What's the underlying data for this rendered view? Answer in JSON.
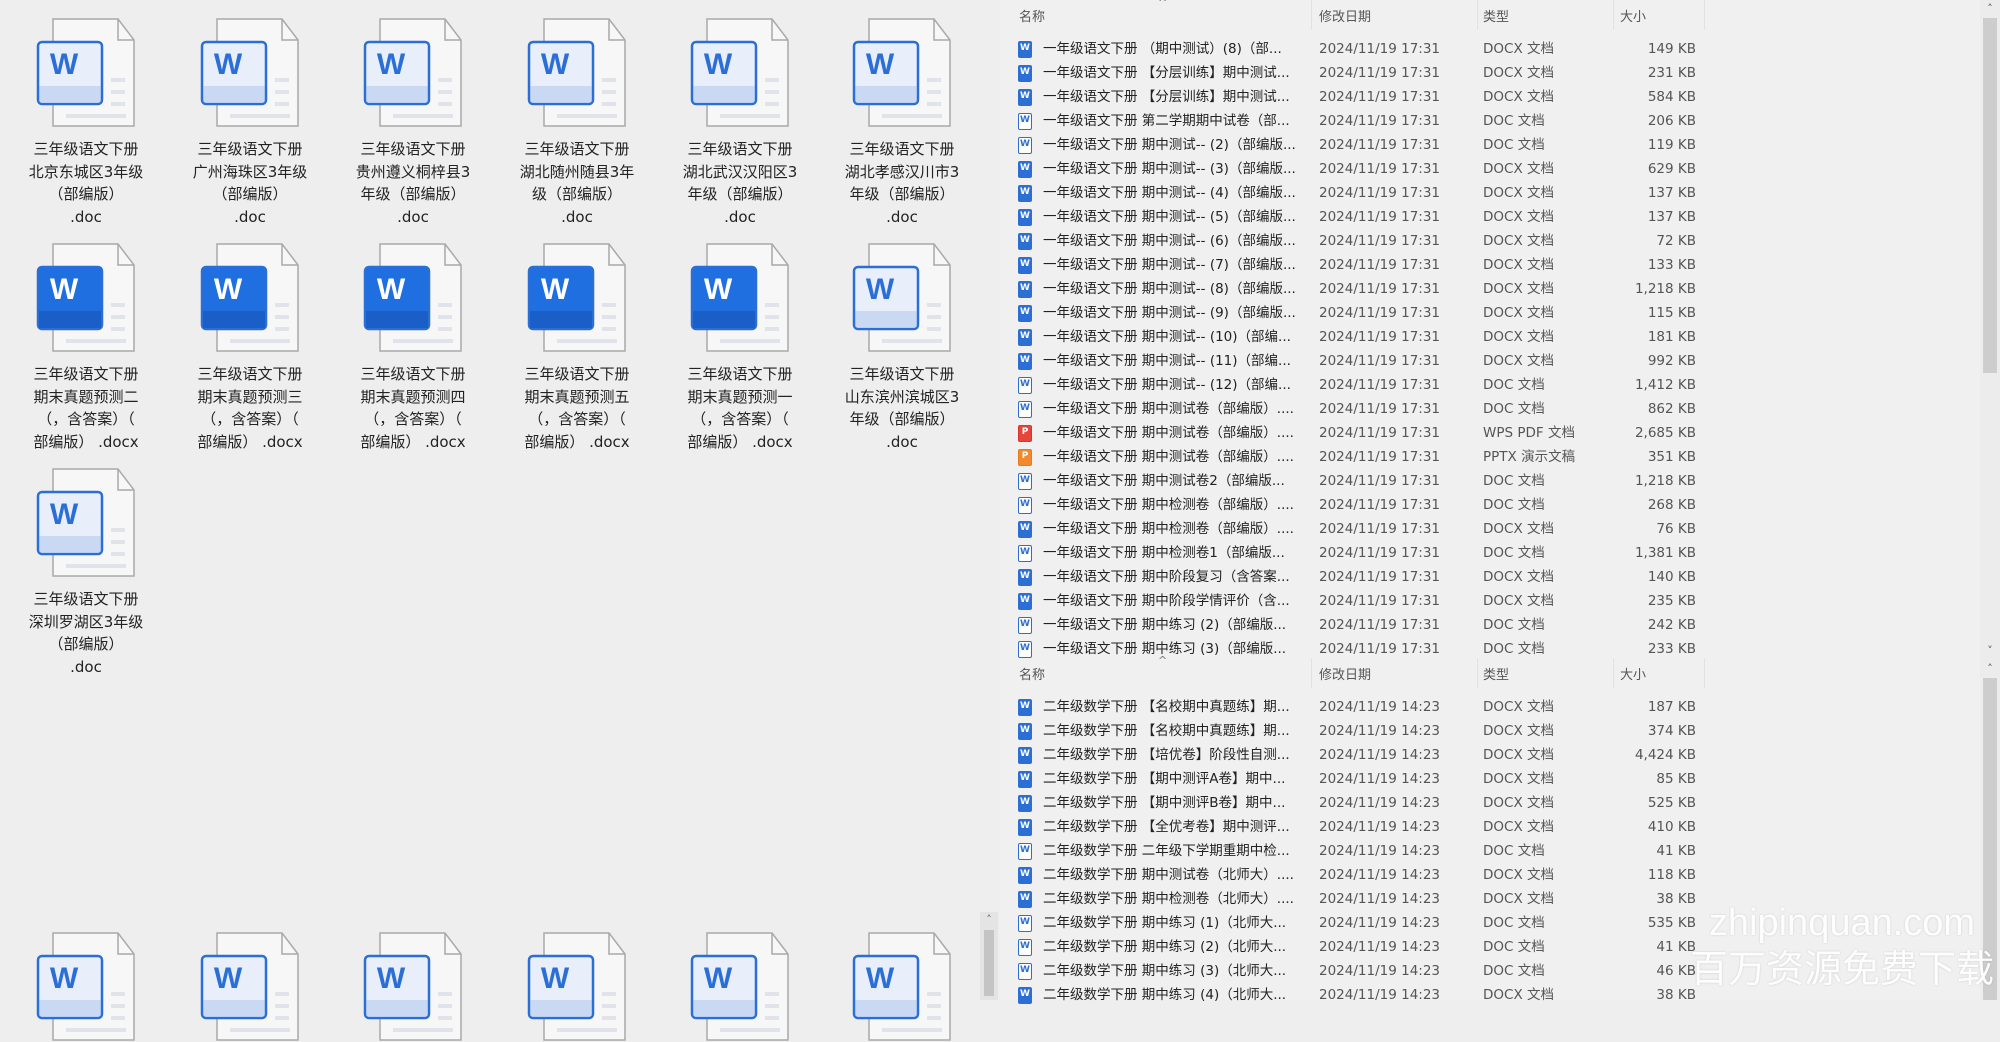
{
  "grid": {
    "items": [
      {
        "label": "三年级语文下册\n北京东城区3年级\n（部编版）\n.doc",
        "style": "doc"
      },
      {
        "label": "三年级语文下册\n广州海珠区3年级\n（部编版）\n.doc",
        "style": "doc"
      },
      {
        "label": "三年级语文下册\n贵州遵义桐梓县3\n年级（部编版）\n.doc",
        "style": "doc"
      },
      {
        "label": "三年级语文下册\n湖北随州随县3年\n级（部编版）\n.doc",
        "style": "doc"
      },
      {
        "label": "三年级语文下册\n湖北武汉汉阳区3\n年级（部编版）\n.doc",
        "style": "doc"
      },
      {
        "label": "三年级语文下册\n湖北孝感汉川市3\n年级（部编版）\n.doc",
        "style": "doc"
      },
      {
        "label": "三年级语文下册\n期末真题预测二\n（，含答案）（\n部编版） .docx",
        "style": "docx"
      },
      {
        "label": "三年级语文下册\n期末真题预测三\n（，含答案）（\n部编版） .docx",
        "style": "docx"
      },
      {
        "label": "三年级语文下册\n期末真题预测四\n（，含答案）（\n部编版） .docx",
        "style": "docx"
      },
      {
        "label": "三年级语文下册\n期末真题预测五\n（，含答案）（\n部编版） .docx",
        "style": "docx"
      },
      {
        "label": "三年级语文下册\n期末真题预测一\n（，含答案）（\n部编版） .docx",
        "style": "docx"
      },
      {
        "label": "三年级语文下册\n山东滨州滨城区3\n年级（部编版）\n.doc",
        "style": "doc"
      },
      {
        "label": "三年级语文下册\n深圳罗湖区3年级\n（部编版）\n.doc",
        "style": "doc"
      }
    ],
    "lower_items": [
      "doc",
      "doc",
      "doc",
      "doc",
      "doc",
      "doc"
    ]
  },
  "columns": {
    "name": "名称",
    "date": "修改日期",
    "type": "类型",
    "size": "大小"
  },
  "list1": [
    [
      "docx",
      "一年级语文下册 （期中测试）(8)（部...",
      "2024/11/19 17:31",
      "DOCX 文档",
      "149 KB"
    ],
    [
      "docx",
      "一年级语文下册 【分层训练】期中测试...",
      "2024/11/19 17:31",
      "DOCX 文档",
      "231 KB"
    ],
    [
      "docx",
      "一年级语文下册 【分层训练】期中测试...",
      "2024/11/19 17:31",
      "DOCX 文档",
      "584 KB"
    ],
    [
      "doc",
      "一年级语文下册 第二学期期中试卷（部...",
      "2024/11/19 17:31",
      "DOC 文档",
      "206 KB"
    ],
    [
      "doc",
      "一年级语文下册 期中测试-- (2)（部编版...",
      "2024/11/19 17:31",
      "DOC 文档",
      "119 KB"
    ],
    [
      "docx",
      "一年级语文下册 期中测试-- (3)（部编版...",
      "2024/11/19 17:31",
      "DOCX 文档",
      "629 KB"
    ],
    [
      "docx",
      "一年级语文下册 期中测试-- (4)（部编版...",
      "2024/11/19 17:31",
      "DOCX 文档",
      "137 KB"
    ],
    [
      "docx",
      "一年级语文下册 期中测试-- (5)（部编版...",
      "2024/11/19 17:31",
      "DOCX 文档",
      "137 KB"
    ],
    [
      "docx",
      "一年级语文下册 期中测试-- (6)（部编版...",
      "2024/11/19 17:31",
      "DOCX 文档",
      "72 KB"
    ],
    [
      "docx",
      "一年级语文下册 期中测试-- (7)（部编版...",
      "2024/11/19 17:31",
      "DOCX 文档",
      "133 KB"
    ],
    [
      "docx",
      "一年级语文下册 期中测试-- (8)（部编版...",
      "2024/11/19 17:31",
      "DOCX 文档",
      "1,218 KB"
    ],
    [
      "docx",
      "一年级语文下册 期中测试-- (9)（部编版...",
      "2024/11/19 17:31",
      "DOCX 文档",
      "115 KB"
    ],
    [
      "docx",
      "一年级语文下册 期中测试-- (10)（部编...",
      "2024/11/19 17:31",
      "DOCX 文档",
      "181 KB"
    ],
    [
      "docx",
      "一年级语文下册 期中测试-- (11)（部编...",
      "2024/11/19 17:31",
      "DOCX 文档",
      "992 KB"
    ],
    [
      "doc",
      "一年级语文下册 期中测试-- (12)（部编...",
      "2024/11/19 17:31",
      "DOC 文档",
      "1,412 KB"
    ],
    [
      "doc",
      "一年级语文下册 期中测试卷（部编版）....",
      "2024/11/19 17:31",
      "DOC 文档",
      "862 KB"
    ],
    [
      "pdf",
      "一年级语文下册 期中测试卷（部编版）....",
      "2024/11/19 17:31",
      "WPS PDF 文档",
      "2,685 KB"
    ],
    [
      "pptx",
      "一年级语文下册 期中测试卷（部编版）....",
      "2024/11/19 17:31",
      "PPTX 演示文稿",
      "351 KB"
    ],
    [
      "doc",
      "一年级语文下册 期中测试卷2（部编版...",
      "2024/11/19 17:31",
      "DOC 文档",
      "1,218 KB"
    ],
    [
      "doc",
      "一年级语文下册 期中检测卷（部编版）....",
      "2024/11/19 17:31",
      "DOC 文档",
      "268 KB"
    ],
    [
      "docx",
      "一年级语文下册 期中检测卷（部编版）....",
      "2024/11/19 17:31",
      "DOCX 文档",
      "76 KB"
    ],
    [
      "doc",
      "一年级语文下册 期中检测卷1（部编版...",
      "2024/11/19 17:31",
      "DOC 文档",
      "1,381 KB"
    ],
    [
      "docx",
      "一年级语文下册 期中阶段复习（含答案...",
      "2024/11/19 17:31",
      "DOCX 文档",
      "140 KB"
    ],
    [
      "docx",
      "一年级语文下册 期中阶段学情评价（含...",
      "2024/11/19 17:31",
      "DOCX 文档",
      "235 KB"
    ],
    [
      "doc",
      "一年级语文下册 期中练习 (2)（部编版...",
      "2024/11/19 17:31",
      "DOC 文档",
      "242 KB"
    ],
    [
      "doc",
      "一年级语文下册 期中练习 (3)（部编版...",
      "2024/11/19 17:31",
      "DOC 文档",
      "233 KB"
    ]
  ],
  "list2": [
    [
      "docx",
      "二年级数学下册 【名校期中真题练】期...",
      "2024/11/19 14:23",
      "DOCX 文档",
      "187 KB"
    ],
    [
      "docx",
      "二年级数学下册 【名校期中真题练】期...",
      "2024/11/19 14:23",
      "DOCX 文档",
      "374 KB"
    ],
    [
      "docx",
      "二年级数学下册 【培优卷】阶段性自测...",
      "2024/11/19 14:23",
      "DOCX 文档",
      "4,424 KB"
    ],
    [
      "docx",
      "二年级数学下册 【期中测评A卷】期中...",
      "2024/11/19 14:23",
      "DOCX 文档",
      "85 KB"
    ],
    [
      "docx",
      "二年级数学下册 【期中测评B卷】期中...",
      "2024/11/19 14:23",
      "DOCX 文档",
      "525 KB"
    ],
    [
      "docx",
      "二年级数学下册 【全优考卷】期中测评...",
      "2024/11/19 14:23",
      "DOCX 文档",
      "410 KB"
    ],
    [
      "doc",
      "二年级数学下册 二年级下学期重期中检...",
      "2024/11/19 14:23",
      "DOC 文档",
      "41 KB"
    ],
    [
      "docx",
      "二年级数学下册 期中测试卷（北师大）....",
      "2024/11/19 14:23",
      "DOCX 文档",
      "118 KB"
    ],
    [
      "docx",
      "二年级数学下册 期中检测卷（北师大）....",
      "2024/11/19 14:23",
      "DOCX 文档",
      "38 KB"
    ],
    [
      "doc",
      "二年级数学下册 期中练习 (1)（北师大...",
      "2024/11/19 14:23",
      "DOC 文档",
      "535 KB"
    ],
    [
      "doc",
      "二年级数学下册 期中练习 (2)（北师大...",
      "2024/11/19 14:23",
      "DOC 文档",
      "41 KB"
    ],
    [
      "doc",
      "二年级数学下册 期中练习 (3)（北师大...",
      "2024/11/19 14:23",
      "DOC 文档",
      "46 KB"
    ],
    [
      "docx",
      "二年级数学下册 期中练习 (4)（北师大...",
      "2024/11/19 14:23",
      "DOCX 文档",
      "38 KB"
    ]
  ],
  "watermark": {
    "line1": "zhipinquan.com",
    "line2": "百万资源免费下载"
  },
  "scroll_arrows": {
    "up": "˄",
    "down": "˅"
  }
}
